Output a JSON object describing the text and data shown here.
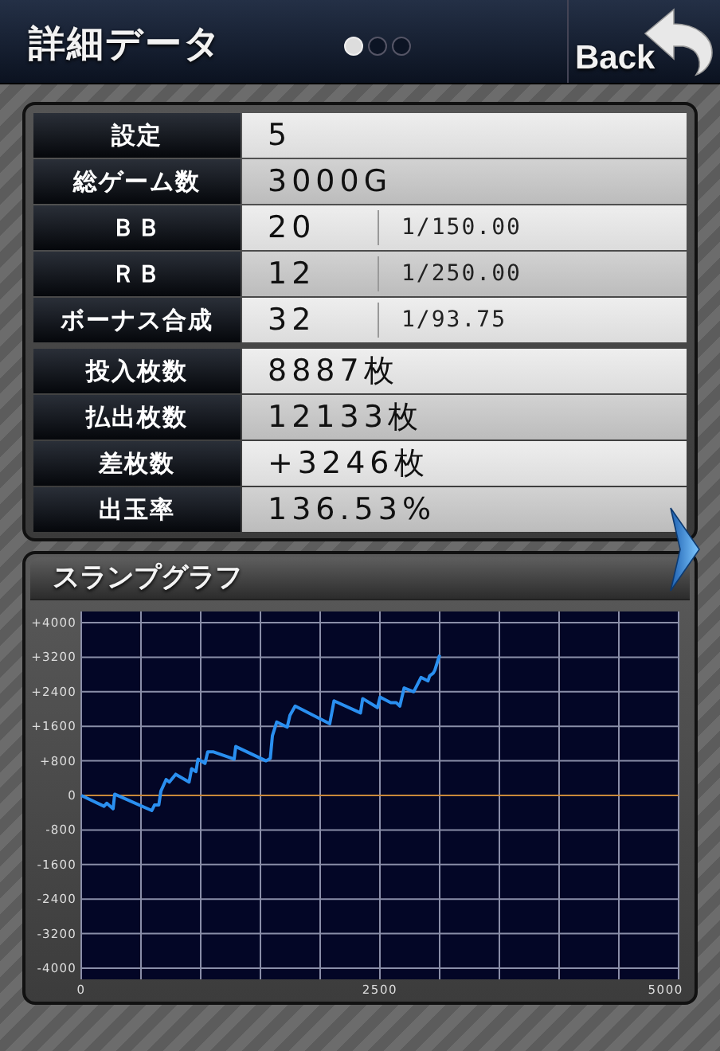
{
  "header": {
    "title": "詳細データ",
    "page_dots": [
      {
        "selected": true
      },
      {
        "selected": false
      },
      {
        "selected": false
      }
    ],
    "back_button": "Back"
  },
  "stats": {
    "groups": [
      {
        "rows": [
          {
            "label": "設定",
            "value": "5"
          },
          {
            "label": "総ゲーム数",
            "value": "3000G"
          },
          {
            "label": "ＢＢ",
            "value": "20",
            "rate": "1/150.00"
          },
          {
            "label": "ＲＢ",
            "value": "12",
            "rate": "1/250.00"
          },
          {
            "label": "ボーナス合成",
            "value": "32",
            "rate": "1/93.75"
          }
        ]
      },
      {
        "rows": [
          {
            "label": "投入枚数",
            "value": "8887枚"
          },
          {
            "label": "払出枚数",
            "value": "12133枚"
          },
          {
            "label": "差枚数",
            "value": "+3246枚"
          },
          {
            "label": "出玉率",
            "value": "136.53%"
          }
        ]
      }
    ]
  },
  "slump_graph": {
    "title": "スランプグラフ",
    "chart_data": {
      "type": "line",
      "xlim": [
        0,
        5000
      ],
      "ylim": [
        -4000,
        4000
      ],
      "xticks": [
        0,
        2500,
        5000
      ],
      "grid": true,
      "ref_lines": [
        {
          "axis": "y",
          "value": 0,
          "color": "#c8883a"
        }
      ],
      "yticks": [
        {
          "value": 4000,
          "label": "+4000"
        },
        {
          "value": 3200,
          "label": "+3200"
        },
        {
          "value": 2400,
          "label": "+2400"
        },
        {
          "value": 1600,
          "label": "+1600"
        },
        {
          "value": 800,
          "label": "+800"
        },
        {
          "value": 0,
          "label": "0"
        },
        {
          "value": -800,
          "label": "-800"
        },
        {
          "value": -1600,
          "label": "-1600"
        },
        {
          "value": -2400,
          "label": "-2400"
        },
        {
          "value": -3200,
          "label": "-3200"
        },
        {
          "value": -4000,
          "label": "-4000"
        }
      ],
      "x": [
        0,
        191,
        213,
        267,
        280,
        591,
        613,
        649,
        667,
        711,
        738,
        791,
        902,
        924,
        960,
        978,
        1036,
        1058,
        1102,
        1280,
        1293,
        1547,
        1582,
        1600,
        1636,
        1724,
        1747,
        1791,
        2080,
        2116,
        2338,
        2356,
        2480,
        2502,
        2591,
        2636,
        2667,
        2702,
        2782,
        2844,
        2902,
        2916,
        2947,
        2960,
        3000
      ],
      "series": [
        {
          "color": "#2a8ff0",
          "values": [
            0,
            -250,
            -180,
            -310,
            30,
            -350,
            -220,
            -220,
            100,
            370,
            310,
            490,
            310,
            620,
            550,
            840,
            740,
            1010,
            1010,
            840,
            1130,
            800,
            860,
            1380,
            1700,
            1580,
            1850,
            2070,
            1660,
            2190,
            1910,
            2240,
            2030,
            2280,
            2150,
            2150,
            2070,
            2490,
            2400,
            2730,
            2650,
            2770,
            2830,
            2900,
            3250
          ]
        }
      ]
    }
  }
}
